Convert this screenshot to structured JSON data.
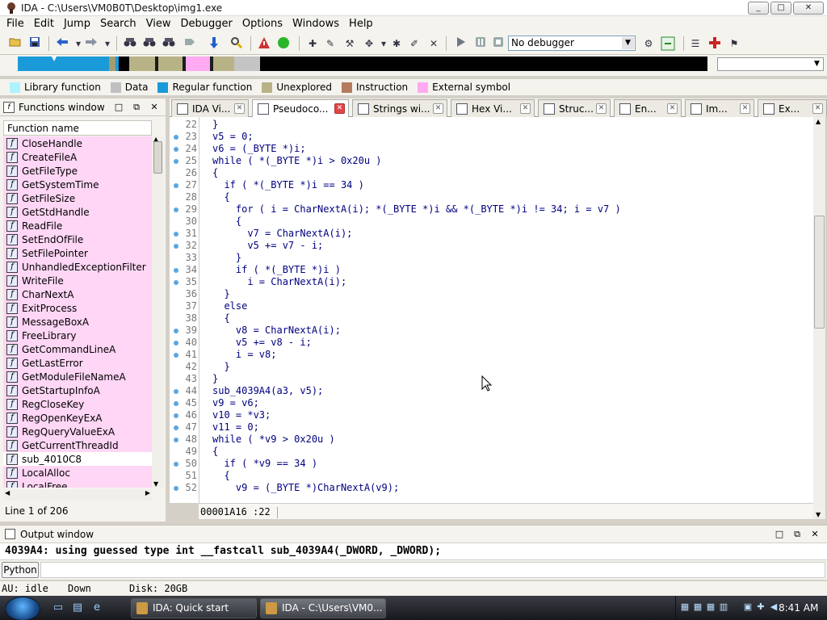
{
  "window": {
    "title": "IDA - C:\\Users\\VM0B0T\\Desktop\\img1.exe",
    "min": "_",
    "max": "□",
    "close": "✕"
  },
  "menu": [
    "File",
    "Edit",
    "Jump",
    "Search",
    "View",
    "Debugger",
    "Options",
    "Windows",
    "Help"
  ],
  "toolbar": {
    "debugger_value": "No debugger",
    "icons": [
      "folder-open-icon",
      "save-icon",
      "back-arrow-icon",
      "dropdown-arrow-icon",
      "forward-arrow-icon",
      "dropdown-arrow-icon",
      "binoculars-text-icon",
      "binoculars-hex-icon",
      "binoculars-immediate-icon",
      "find-next-icon",
      "jump-down-icon",
      "search-mark-icon",
      "graph-icon",
      "run-green-icon",
      "add-segment-icon",
      "edit-segment-icon",
      "struct-icon",
      "enum-icon",
      "patch-icon",
      "rename-icon",
      "cross-icon",
      "play-icon",
      "pause-icon",
      "stop-icon",
      "debug-attach-icon",
      "debug-trace-icon",
      "list-icon",
      "plus-red-icon",
      "tools-icon"
    ]
  },
  "navband": {
    "segments": [
      {
        "color": "#1a9ad8",
        "w": 113
      },
      {
        "color": "#a59b6e",
        "w": 8
      },
      {
        "color": "#1a9ad8",
        "w": 4
      },
      {
        "color": "#000000",
        "w": 13
      },
      {
        "color": "#b8b386",
        "w": 32
      },
      {
        "color": "#1c1c1c",
        "w": 4
      },
      {
        "color": "#b8b386",
        "w": 30
      },
      {
        "color": "#1c1c1c",
        "w": 4
      },
      {
        "color": "#ffaaf2",
        "w": 30
      },
      {
        "color": "#1c1c1c",
        "w": 4
      },
      {
        "color": "#b8b386",
        "w": 26
      },
      {
        "color": "#c4c4c4",
        "w": 32
      },
      {
        "color": "#000000",
        "w": 554
      }
    ]
  },
  "legend": [
    {
      "label": "Library function",
      "color": "#aef2ff"
    },
    {
      "label": "Data",
      "color": "#c0c0c0"
    },
    {
      "label": "Regular function",
      "color": "#1a9ad8"
    },
    {
      "label": "Unexplored",
      "color": "#b8b386"
    },
    {
      "label": "Instruction",
      "color": "#b57a5e"
    },
    {
      "label": "External symbol",
      "color": "#ffaaf2"
    }
  ],
  "functions_window": {
    "title": "Functions window",
    "column": "Function name",
    "items": [
      "CloseHandle",
      "CreateFileA",
      "GetFileType",
      "GetSystemTime",
      "GetFileSize",
      "GetStdHandle",
      "ReadFile",
      "SetEndOfFile",
      "SetFilePointer",
      "UnhandledExceptionFilter",
      "WriteFile",
      "CharNextA",
      "ExitProcess",
      "MessageBoxA",
      "FreeLibrary",
      "GetCommandLineA",
      "GetLastError",
      "GetModuleFileNameA",
      "GetStartupInfoA",
      "RegCloseKey",
      "RegOpenKeyExA",
      "RegQueryValueExA",
      "GetCurrentThreadId",
      "sub_4010C8",
      "LocalAlloc",
      "LocalFree"
    ],
    "status": "Line 1 of 206"
  },
  "tabs": [
    {
      "label": "IDA Vi...",
      "icon": "ida-view-icon"
    },
    {
      "label": "Pseudoco...",
      "icon": "pseudocode-icon"
    },
    {
      "label": "Strings wi...",
      "icon": "strings-icon"
    },
    {
      "label": "Hex Vi...",
      "icon": "hex-view-icon"
    },
    {
      "label": "Struc...",
      "icon": "structures-icon"
    },
    {
      "label": "En...",
      "icon": "enums-icon"
    },
    {
      "label": "Im...",
      "icon": "imports-icon"
    },
    {
      "label": "Ex...",
      "icon": "exports-icon"
    }
  ],
  "code": [
    {
      "n": "22",
      "dot": false,
      "t": "}"
    },
    {
      "n": "23",
      "dot": true,
      "t": "v5 = 0;"
    },
    {
      "n": "24",
      "dot": true,
      "t": "v6 = (_BYTE *)i;"
    },
    {
      "n": "25",
      "dot": true,
      "t": "while ( *(_BYTE *)i > 0x20u )"
    },
    {
      "n": "26",
      "dot": false,
      "t": "{"
    },
    {
      "n": "27",
      "dot": true,
      "t": "  if ( *(_BYTE *)i == 34 )"
    },
    {
      "n": "28",
      "dot": false,
      "t": "  {"
    },
    {
      "n": "29",
      "dot": true,
      "t": "    for ( i = CharNextA(i); *(_BYTE *)i && *(_BYTE *)i != 34; i = v7 )"
    },
    {
      "n": "30",
      "dot": false,
      "t": "    {"
    },
    {
      "n": "31",
      "dot": true,
      "t": "      v7 = CharNextA(i);"
    },
    {
      "n": "32",
      "dot": true,
      "t": "      v5 += v7 - i;"
    },
    {
      "n": "33",
      "dot": false,
      "t": "    }"
    },
    {
      "n": "34",
      "dot": true,
      "t": "    if ( *(_BYTE *)i )"
    },
    {
      "n": "35",
      "dot": true,
      "t": "      i = CharNextA(i);"
    },
    {
      "n": "36",
      "dot": false,
      "t": "  }"
    },
    {
      "n": "37",
      "dot": false,
      "t": "  else"
    },
    {
      "n": "38",
      "dot": false,
      "t": "  {"
    },
    {
      "n": "39",
      "dot": true,
      "t": "    v8 = CharNextA(i);"
    },
    {
      "n": "40",
      "dot": true,
      "t": "    v5 += v8 - i;"
    },
    {
      "n": "41",
      "dot": true,
      "t": "    i = v8;"
    },
    {
      "n": "42",
      "dot": false,
      "t": "  }"
    },
    {
      "n": "43",
      "dot": false,
      "t": "}"
    },
    {
      "n": "44",
      "dot": true,
      "t": "sub_4039A4(a3, v5);"
    },
    {
      "n": "45",
      "dot": true,
      "t": "v9 = v6;"
    },
    {
      "n": "46",
      "dot": true,
      "t": "v10 = *v3;"
    },
    {
      "n": "47",
      "dot": true,
      "t": "v11 = 0;"
    },
    {
      "n": "48",
      "dot": true,
      "t": "while ( *v9 > 0x20u )"
    },
    {
      "n": "49",
      "dot": false,
      "t": "{"
    },
    {
      "n": "50",
      "dot": true,
      "t": "  if ( *v9 == 34 )"
    },
    {
      "n": "51",
      "dot": false,
      "t": "  {"
    },
    {
      "n": "52",
      "dot": true,
      "t": "    v9 = (_BYTE *)CharNextA(v9);"
    }
  ],
  "address_bar": {
    "address": "00001A16",
    "line": ":22"
  },
  "output": {
    "title": "Output window",
    "text": "4039A4: using guessed type int __fastcall sub_4039A4(_DWORD, _DWORD);",
    "python_button": "Python"
  },
  "status": {
    "au": "AU:  idle",
    "dir": "Down",
    "disk": "Disk: 20GB"
  },
  "taskbar": {
    "items": [
      {
        "label": "IDA: Quick start"
      },
      {
        "label": "IDA - C:\\Users\\VM0..."
      }
    ],
    "clock": "8:41 AM"
  }
}
